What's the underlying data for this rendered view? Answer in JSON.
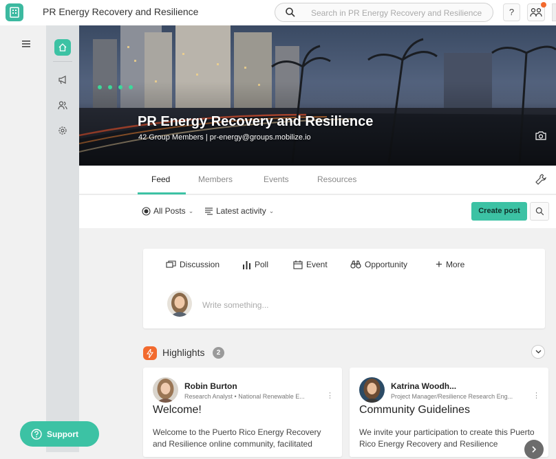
{
  "app": {
    "title": "PR Energy Recovery and Resilience"
  },
  "search": {
    "placeholder": "Search in PR Energy Recovery and Resilience"
  },
  "header": {
    "help_label": "?"
  },
  "hero": {
    "title": "PR Energy Recovery and Resilience",
    "subtitle": "42 Group Members | pr-energy@groups.mobilize.io"
  },
  "tabs": [
    {
      "label": "Feed",
      "active": true
    },
    {
      "label": "Members"
    },
    {
      "label": "Events"
    },
    {
      "label": "Resources"
    }
  ],
  "filters": {
    "posts": "All Posts",
    "sort": "Latest activity"
  },
  "toolbar": {
    "create_post": "Create post"
  },
  "composer": {
    "types": [
      "Discussion",
      "Poll",
      "Event",
      "Opportunity",
      "More"
    ],
    "placeholder": "Write something..."
  },
  "highlights": {
    "title": "Highlights",
    "count": "2",
    "cards": [
      {
        "author": "Robin Burton",
        "role": "Research Analyst • National Renewable E...",
        "title": "Welcome!",
        "body": "Welcome to the Puerto Rico Energy Recovery and Resilience online community, facilitated"
      },
      {
        "author": "Katrina Woodh...",
        "role": "Project Manager/Resilience Research Eng...",
        "title": "Community Guidelines",
        "body": "We invite your participation to create this Puerto Rico Energy Recovery and Resilience"
      }
    ]
  },
  "support": {
    "label": "Support"
  },
  "colors": {
    "accent": "#3cc2a4",
    "highlight": "#f26a2e",
    "rail": "#dde0e2"
  }
}
